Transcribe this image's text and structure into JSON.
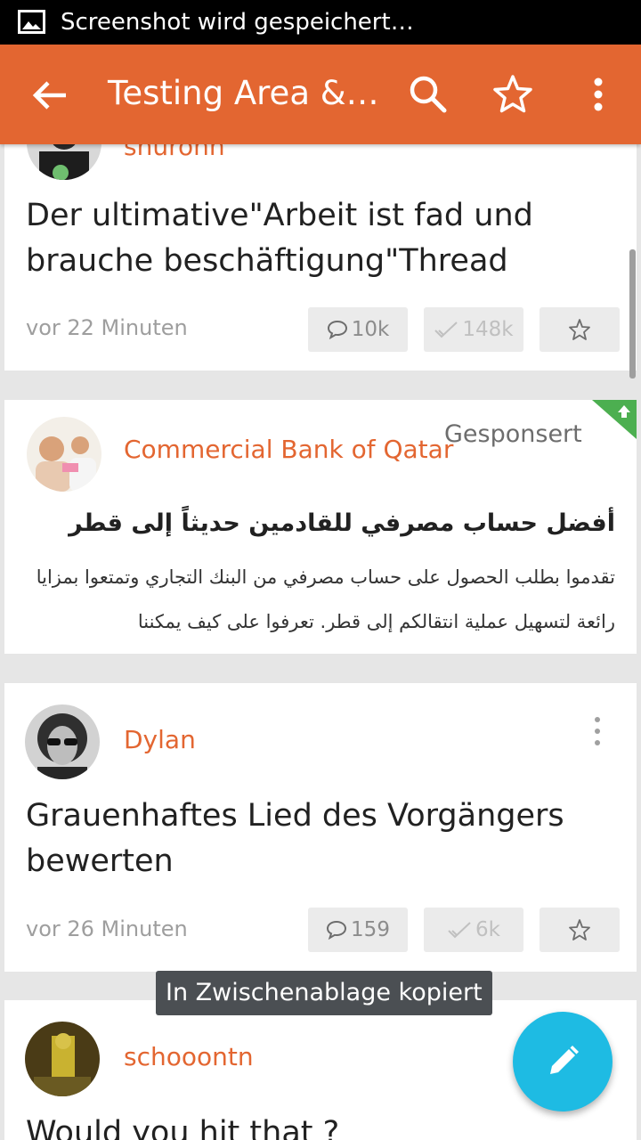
{
  "status_bar": {
    "text": "Screenshot wird gespeichert…",
    "icon": "image-icon"
  },
  "app_bar": {
    "title": "Testing Area &…",
    "back_icon": "arrow-back-icon",
    "search_icon": "search-icon",
    "favorite_icon": "star-outline-icon",
    "more_icon": "more-vert-icon",
    "color": "#e36631"
  },
  "posts": [
    {
      "author": "shurohh",
      "title": "Der ultimative\"Arbeit ist fad und brauche beschäftigung\"Thread",
      "time": "vor 22 Minuten",
      "comments": "10k",
      "likes": "148k"
    },
    {
      "author": "Dylan",
      "title": "Grauenhaftes Lied des Vorgängers bewerten",
      "time": "vor 26 Minuten",
      "comments": "159",
      "likes": "6k"
    },
    {
      "author": "schooontn",
      "title": "Would you hit that ?"
    }
  ],
  "sponsored": {
    "advertiser": "Commercial Bank of Qatar",
    "tag": "Gesponsert",
    "title": "أفضل حساب مصرفي للقادمين حديثاً إلى قطر",
    "body": "تقدموا بطلب الحصول على حساب مصرفي من البنك التجاري وتمتعوا بمزايا رائعة لتسهيل عملية انتقالكم إلى قطر. تعرفوا على كيف يمكننا"
  },
  "toast": "In Zwischenablage kopiert",
  "fab_icon": "pencil-icon",
  "colors": {
    "accent": "#e36631",
    "fab": "#1ebbe3",
    "sponsor_flag": "#4caf50"
  }
}
